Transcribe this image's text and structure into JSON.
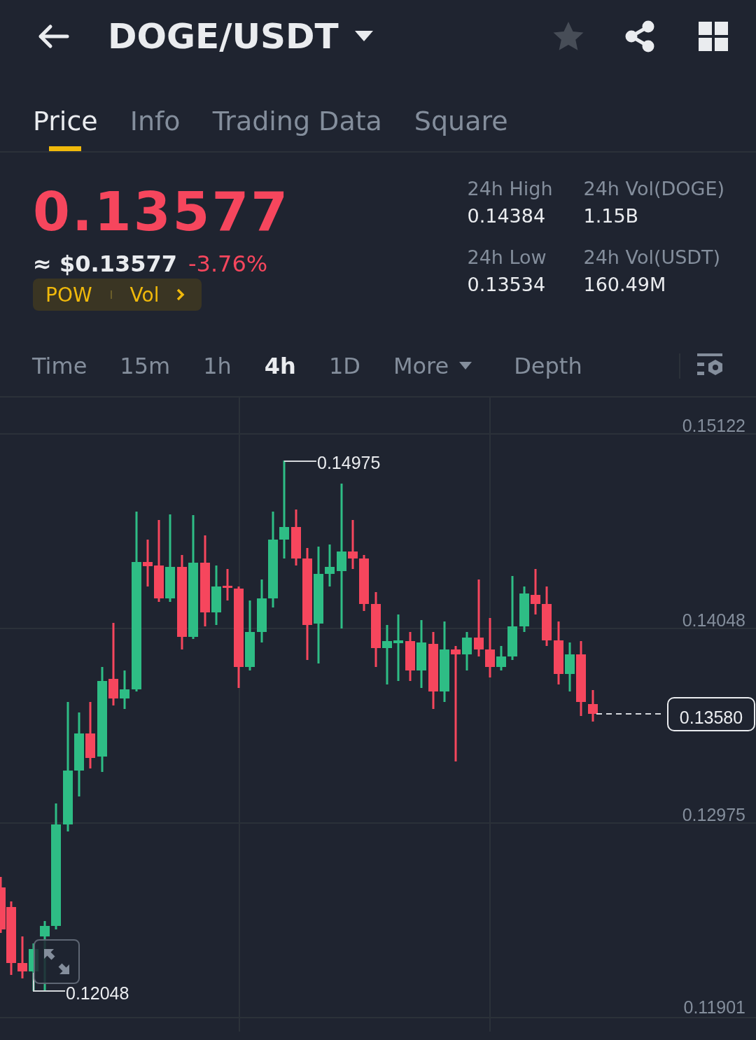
{
  "header": {
    "pair": "DOGE/USDT",
    "favorite": false
  },
  "tabs": [
    {
      "label": "Price",
      "selected": true
    },
    {
      "label": "Info",
      "selected": false
    },
    {
      "label": "Trading Data",
      "selected": false
    },
    {
      "label": "Square",
      "selected": false
    }
  ],
  "ticker": {
    "last": "0.13577",
    "fiat": "≈ $0.13577",
    "change": "-3.76%",
    "tags": [
      "POW",
      "Vol"
    ]
  },
  "stats": [
    {
      "label": "24h High",
      "value": "0.14384"
    },
    {
      "label": "24h Vol(DOGE)",
      "value": "1.15B"
    },
    {
      "label": "24h Low",
      "value": "0.13534"
    },
    {
      "label": "24h Vol(USDT)",
      "value": "160.49M"
    }
  ],
  "intervals": [
    {
      "label": "Time",
      "kind": "interval",
      "selected": false
    },
    {
      "label": "15m",
      "kind": "interval",
      "selected": false
    },
    {
      "label": "1h",
      "kind": "interval",
      "selected": false
    },
    {
      "label": "4h",
      "kind": "interval",
      "selected": true
    },
    {
      "label": "1D",
      "kind": "interval",
      "selected": false
    },
    {
      "label": "More",
      "kind": "dropdown",
      "selected": false
    },
    {
      "label": "Depth",
      "kind": "view",
      "selected": false
    }
  ],
  "chart": {
    "price_labels": [
      "0.15122",
      "0.14048",
      "0.12975",
      "0.11901"
    ],
    "high_marker": "0.14975",
    "low_marker": "0.12048",
    "last_price": "0.13580"
  }
}
